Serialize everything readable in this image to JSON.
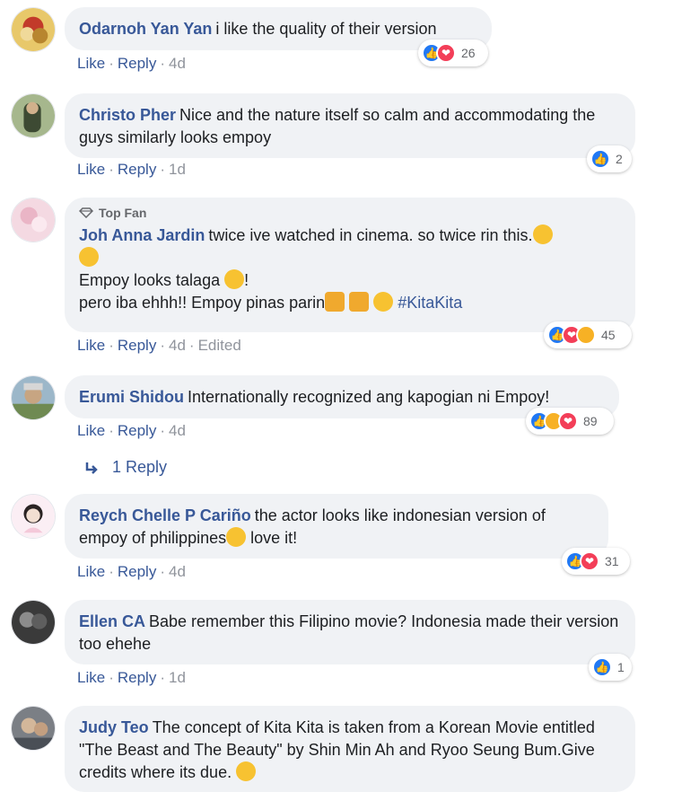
{
  "comments": [
    {
      "name": "Odarnoh Yan Yan",
      "text": "i like the quality of their version",
      "actions": {
        "like": "Like",
        "reply": "Reply",
        "time": "4d"
      },
      "reaction_count": "26",
      "reactions": [
        "like",
        "love"
      ]
    },
    {
      "name": "Christo Pher",
      "text": "Nice and the nature itself so calm and accommodating the guys similarly looks empoy",
      "actions": {
        "like": "Like",
        "reply": "Reply",
        "time": "1d"
      },
      "reaction_count": "2",
      "reactions": [
        "like"
      ]
    },
    {
      "badge": "Top Fan",
      "name": "Joh Anna Jardin",
      "text": "twice ive watched in cinema. so twice rin this.",
      "line2": "Empoy looks talaga",
      "line3": "pero iba ehhh!! Empoy pinas parin",
      "hashtag": "#KitaKita",
      "actions": {
        "like": "Like",
        "reply": "Reply",
        "time": "4d",
        "edited": "Edited"
      },
      "reaction_count": "45",
      "reactions": [
        "like",
        "love",
        "haha"
      ]
    },
    {
      "name": "Erumi Shidou",
      "text": "Internationally recognized ang kapogian ni Empoy!",
      "actions": {
        "like": "Like",
        "reply": "Reply",
        "time": "4d"
      },
      "reaction_count": "89",
      "reactions": [
        "like",
        "haha",
        "love"
      ],
      "replies_label": "1 Reply"
    },
    {
      "name": "Reych Chelle P Cariño",
      "text": "the actor looks like indonesian version of empoy of philippines",
      "text_end": "love it!",
      "actions": {
        "like": "Like",
        "reply": "Reply",
        "time": "4d"
      },
      "reaction_count": "31",
      "reactions": [
        "like",
        "love"
      ]
    },
    {
      "name": "Ellen CA",
      "text": "Babe remember this Filipino movie? Indonesia made their version too ehehe",
      "actions": {
        "like": "Like",
        "reply": "Reply",
        "time": "1d"
      },
      "reaction_count": "1",
      "reactions": [
        "like"
      ]
    },
    {
      "name": "Judy Teo",
      "text": "The concept of Kita Kita is taken from a Korean Movie entitled \"The Beast and The Beauty\" by Shin Min Ah and Ryoo Seung Bum.Give credits where its due."
    }
  ],
  "colors": {
    "link": "#385898",
    "bubble": "#f0f2f5",
    "like": "#2078f4",
    "love": "#f33e58",
    "haha": "#f7b125"
  }
}
